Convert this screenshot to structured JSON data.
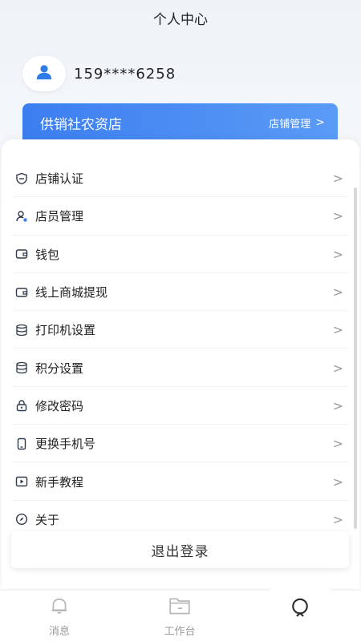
{
  "header": {
    "title": "个人中心"
  },
  "user": {
    "phone": "159****6258",
    "avatar_icon": "user-icon"
  },
  "store": {
    "name": "供销社农资店",
    "manage_label": "店铺管理",
    "manage_chevron": ">"
  },
  "menu": {
    "items": [
      {
        "label": "店铺认证",
        "icon": "shield-icon"
      },
      {
        "label": "店员管理",
        "icon": "staff-icon"
      },
      {
        "label": "钱包",
        "icon": "wallet-icon"
      },
      {
        "label": "线上商城提现",
        "icon": "withdraw-icon"
      },
      {
        "label": "打印机设置",
        "icon": "database-icon"
      },
      {
        "label": "积分设置",
        "icon": "stack-icon"
      },
      {
        "label": "修改密码",
        "icon": "lock-icon"
      },
      {
        "label": "更换手机号",
        "icon": "phone-icon"
      },
      {
        "label": "新手教程",
        "icon": "play-icon"
      },
      {
        "label": "关于",
        "icon": "compass-icon"
      }
    ],
    "chevron": ">"
  },
  "logout": {
    "label": "退出登录"
  },
  "tabbar": {
    "tabs": [
      {
        "label": "消息",
        "icon": "bell-icon"
      },
      {
        "label": "工作台",
        "icon": "folder-icon"
      },
      {
        "label": "",
        "icon": "person-outline-icon"
      }
    ]
  },
  "colors": {
    "accent": "#3c7ef0",
    "icon": "#2f3a4a"
  }
}
